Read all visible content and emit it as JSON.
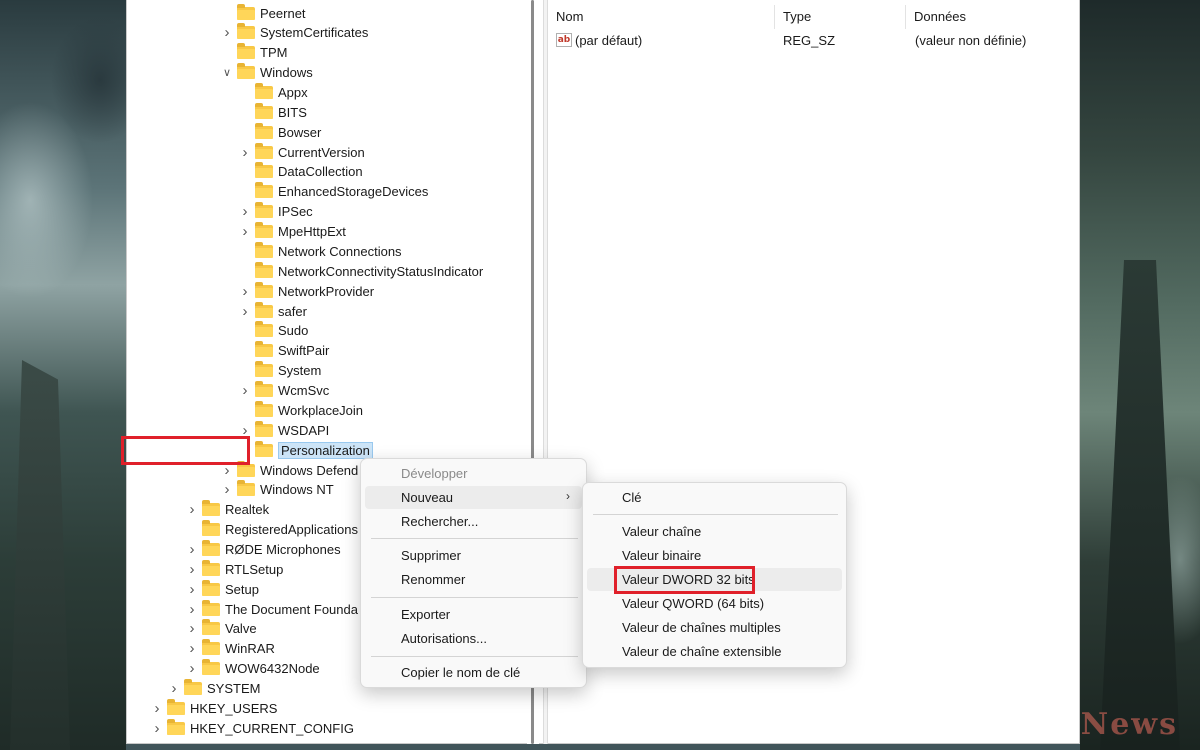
{
  "tree": {
    "items": [
      {
        "label": "Peernet",
        "has_children": false,
        "expanded": false
      },
      {
        "label": "SystemCertificates",
        "has_children": true,
        "expanded": false
      },
      {
        "label": "TPM",
        "has_children": false,
        "expanded": false
      },
      {
        "label": "Windows",
        "has_children": true,
        "expanded": true
      },
      {
        "label": "Appx",
        "has_children": false,
        "expanded": false
      },
      {
        "label": "BITS",
        "has_children": false,
        "expanded": false
      },
      {
        "label": "Bowser",
        "has_children": false,
        "expanded": false
      },
      {
        "label": "CurrentVersion",
        "has_children": true,
        "expanded": false
      },
      {
        "label": "DataCollection",
        "has_children": false,
        "expanded": false
      },
      {
        "label": "EnhancedStorageDevices",
        "has_children": false,
        "expanded": false
      },
      {
        "label": "IPSec",
        "has_children": true,
        "expanded": false
      },
      {
        "label": "MpeHttpExt",
        "has_children": true,
        "expanded": false
      },
      {
        "label": "Network Connections",
        "has_children": false,
        "expanded": false
      },
      {
        "label": "NetworkConnectivityStatusIndicator",
        "has_children": false,
        "expanded": false
      },
      {
        "label": "NetworkProvider",
        "has_children": true,
        "expanded": false
      },
      {
        "label": "safer",
        "has_children": true,
        "expanded": false
      },
      {
        "label": "Sudo",
        "has_children": false,
        "expanded": false
      },
      {
        "label": "SwiftPair",
        "has_children": false,
        "expanded": false
      },
      {
        "label": "System",
        "has_children": false,
        "expanded": false
      },
      {
        "label": "WcmSvc",
        "has_children": true,
        "expanded": false
      },
      {
        "label": "WorkplaceJoin",
        "has_children": false,
        "expanded": false
      },
      {
        "label": "WSDAPI",
        "has_children": true,
        "expanded": false
      },
      {
        "label": "Personalization",
        "has_children": false,
        "expanded": false,
        "selected": true
      },
      {
        "label": "Windows Defend",
        "has_children": true,
        "expanded": false
      },
      {
        "label": "Windows NT",
        "has_children": true,
        "expanded": false
      },
      {
        "label": "Realtek",
        "has_children": true,
        "expanded": false
      },
      {
        "label": "RegisteredApplications",
        "has_children": false,
        "expanded": false
      },
      {
        "label": "RØDE Microphones",
        "has_children": true,
        "expanded": false
      },
      {
        "label": "RTLSetup",
        "has_children": true,
        "expanded": false
      },
      {
        "label": "Setup",
        "has_children": true,
        "expanded": false
      },
      {
        "label": "The Document Founda",
        "has_children": true,
        "expanded": false
      },
      {
        "label": "Valve",
        "has_children": true,
        "expanded": false
      },
      {
        "label": "WinRAR",
        "has_children": true,
        "expanded": false
      },
      {
        "label": "WOW6432Node",
        "has_children": true,
        "expanded": false
      },
      {
        "label": "SYSTEM",
        "has_children": true,
        "expanded": false
      },
      {
        "label": "HKEY_USERS",
        "has_children": true,
        "expanded": false
      },
      {
        "label": "HKEY_CURRENT_CONFIG",
        "has_children": true,
        "expanded": false
      }
    ]
  },
  "list": {
    "columns": {
      "name": "Nom",
      "type": "Type",
      "data": "Données"
    },
    "rows": [
      {
        "name": "(par défaut)",
        "type": "REG_SZ",
        "data": "(valeur non définie)",
        "icon": "string-value-icon"
      }
    ]
  },
  "context_menu": {
    "expand": "Développer",
    "new": "Nouveau",
    "find": "Rechercher...",
    "delete": "Supprimer",
    "rename": "Renommer",
    "export": "Exporter",
    "permissions": "Autorisations...",
    "copy_key_name": "Copier le nom de clé"
  },
  "submenu": {
    "key": "Clé",
    "string_value": "Valeur chaîne",
    "binary_value": "Valeur binaire",
    "dword_value": "Valeur DWORD 32 bits",
    "qword_value": "Valeur QWORD (64 bits)",
    "multi_string_value": "Valeur de chaînes multiples",
    "expandable_string_value": "Valeur de chaîne extensible"
  },
  "watermark": "IT News",
  "colors": {
    "highlight_red": "#e0202a",
    "selection_blue": "#cce4f7",
    "folder_yellow": "#f8c846"
  }
}
